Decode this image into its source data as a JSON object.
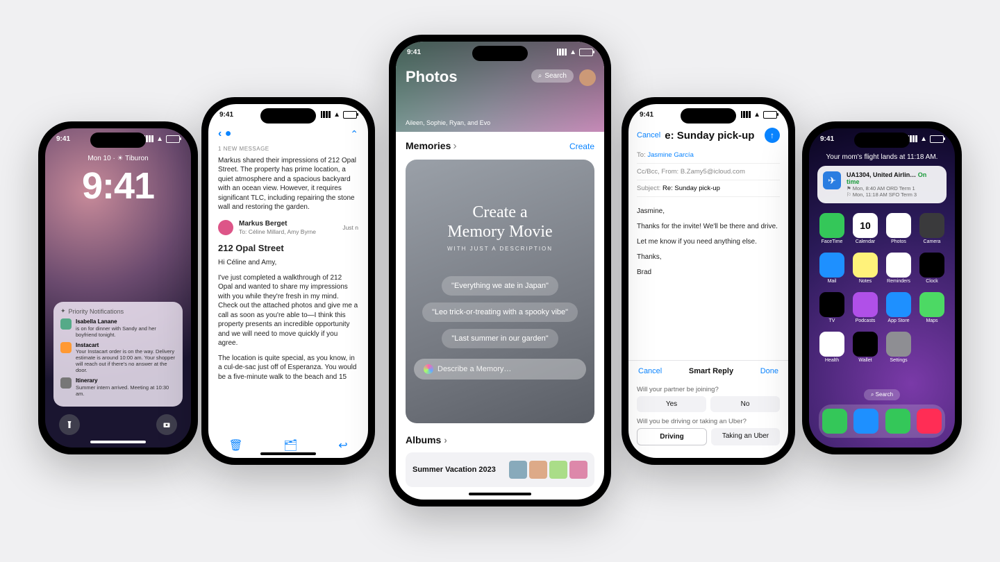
{
  "status_time": "9:41",
  "phone1": {
    "dateline": "Mon 10 · ☀ Tiburon",
    "clock": "9:41",
    "notif_header": "Priority Notifications",
    "n1": {
      "title": "Isabella Lanane",
      "body": "is on for dinner with Sandy and her boyfriend tonight."
    },
    "n2": {
      "title": "Instacart",
      "body": "Your Instacart order is on the way. Delivery estimate is around 10:00 am. Your shopper will reach out if there's no answer at the door."
    },
    "n3": {
      "title": "Itinerary",
      "body": "Summer intern arrived. Meeting at 10:30 am."
    }
  },
  "phone2": {
    "label": "1 NEW MESSAGE",
    "summary": "Markus shared their impressions of 212 Opal Street. The property has prime location, a quiet atmosphere and a spacious backyard with an ocean view. However, it requires significant TLC, including repairing the stone wall and restoring the garden.",
    "sender_name": "Markus Berget",
    "sender_to": "To: Céline Millard, Amy Byrne",
    "sender_time": "Just n",
    "subject": "212 Opal Street",
    "greet": "Hi Céline and Amy,",
    "para1": "I've just completed a walkthrough of 212 Opal and wanted to share my impressions with you while they're fresh in my mind. Check out the attached photos and give me a call as soon as you're able to—I think this property presents an incredible opportunity and we will need to move quickly if you agree.",
    "para2": "The location is quite special, as you know, in a cul-de-sac just off of Esperanza. You would be a five-minute walk to the beach and 15"
  },
  "phone3": {
    "title": "Photos",
    "search": "Search",
    "people": "Aileen, Sophie, Ryan, and Evo",
    "memories": "Memories",
    "create": "Create",
    "card_h1": "Create a",
    "card_h2": "Memory Movie",
    "card_sub": "WITH JUST A DESCRIPTION",
    "chip1": "\"Everything we ate in Japan\"",
    "chip2": "\"Leo trick-or-treating with a spooky vibe\"",
    "chip3": "\"Last summer in our garden\"",
    "input_placeholder": "Describe a Memory…",
    "albums": "Albums",
    "album1": "Summer Vacation 2023"
  },
  "phone4": {
    "cancel": "Cancel",
    "title": "e: Sunday pick-up",
    "to_label": "To:",
    "to_value": "Jasmine García",
    "cc_label": "Cc/Bcc, From:",
    "cc_value": "B.Zamy5@icloud.com",
    "subj_label": "Subject:",
    "subj_value": "Re: Sunday pick-up",
    "greet": "Jasmine,",
    "l1": "Thanks for the invite! We'll be there and drive.",
    "l2": "Let me know if you need anything else.",
    "l3": "Thanks,",
    "l4": "Brad",
    "sr_cancel": "Cancel",
    "sr_title": "Smart Reply",
    "sr_done": "Done",
    "q1": "Will your partner be joining?",
    "q1a": "Yes",
    "q1b": "No",
    "q2": "Will you be driving or taking an Uber?",
    "q2a": "Driving",
    "q2b": "Taking an Uber"
  },
  "phone5": {
    "siri": "Your mom's flight lands at 11:18 AM.",
    "flight_title": "UA1304, United Airlin…",
    "flight_status": "On time",
    "flight_l2": "⚑ Mon, 8:40 AM   ORD Term 1",
    "flight_l3": "⚐ Mon, 11:18 AM   SFO Term 3",
    "apps": [
      {
        "l": "FaceTime",
        "c": "#34c759"
      },
      {
        "l": "Calendar",
        "c": "#ffffff",
        "t": "10"
      },
      {
        "l": "Photos",
        "c": "#ffffff"
      },
      {
        "l": "Camera",
        "c": "#3a3a3c"
      },
      {
        "l": "Mail",
        "c": "#1e90ff"
      },
      {
        "l": "Notes",
        "c": "#fff27a"
      },
      {
        "l": "Reminders",
        "c": "#ffffff"
      },
      {
        "l": "Clock",
        "c": "#000000"
      },
      {
        "l": "TV",
        "c": "#000000"
      },
      {
        "l": "Podcasts",
        "c": "#b050e8"
      },
      {
        "l": "App Store",
        "c": "#1e90ff"
      },
      {
        "l": "Maps",
        "c": "#4cd964"
      },
      {
        "l": "Health",
        "c": "#ffffff"
      },
      {
        "l": "Wallet",
        "c": "#000000"
      },
      {
        "l": "Settings",
        "c": "#8e8e93"
      }
    ],
    "dock": [
      {
        "c": "#34c759"
      },
      {
        "c": "#1e90ff"
      },
      {
        "c": "#34c759"
      },
      {
        "c": "#ff2d55"
      }
    ],
    "search": "Search"
  }
}
